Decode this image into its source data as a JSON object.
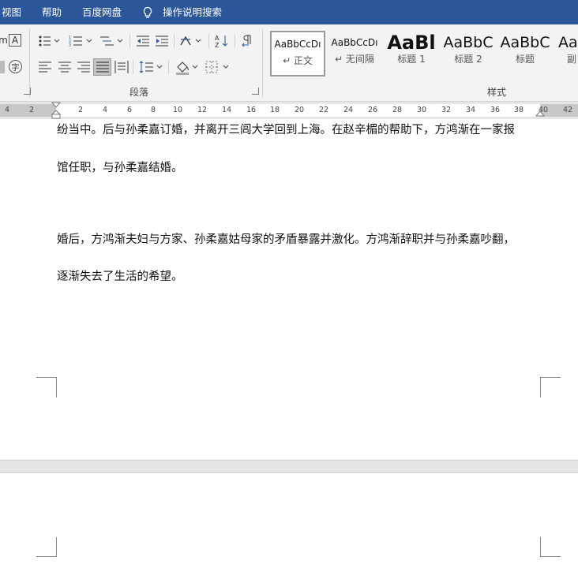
{
  "menubar": {
    "items": [
      "视图",
      "帮助",
      "百度网盘"
    ],
    "search_label": "操作说明搜索",
    "bg_color": "#2b579a"
  },
  "ribbon": {
    "paragraph_group_label": "段落",
    "styles_group_label": "样式",
    "styles": [
      {
        "preview": "AaBbCcDı",
        "name": "↵ 正文",
        "selected": true
      },
      {
        "preview": "AaBbCcDı",
        "name": "↵ 无间隔",
        "selected": false
      },
      {
        "preview": "AaBl",
        "name": "标题 1",
        "selected": false
      },
      {
        "preview": "AaBbC",
        "name": "标题 2",
        "selected": false
      },
      {
        "preview": "AaBbC",
        "name": "标题",
        "selected": false
      },
      {
        "preview": "Aa",
        "name": "副",
        "selected": false
      }
    ],
    "left_partial_label": "m",
    "char_border_label": "A",
    "enclose_char_label": "字"
  },
  "ruler": {
    "left_ticks": [
      "4",
      "2"
    ],
    "ticks": [
      "2",
      "4",
      "6",
      "8",
      "10",
      "12",
      "14",
      "16",
      "18",
      "20",
      "22",
      "24",
      "26",
      "28",
      "30",
      "32",
      "34",
      "36",
      "38",
      "40",
      "42"
    ]
  },
  "document": {
    "lines": [
      "纷当中。后与孙柔嘉订婚，并离开三闾大学回到上海。在赵辛楣的帮助下，方鸿渐在一家报",
      "馆任职，与孙柔嘉结婚。",
      "婚后，方鸿渐夫妇与方家、孙柔嘉姑母家的矛盾暴露并激化。方鸿渐辞职并与孙柔嘉吵翻，",
      "逐渐失去了生活的希望。"
    ]
  }
}
